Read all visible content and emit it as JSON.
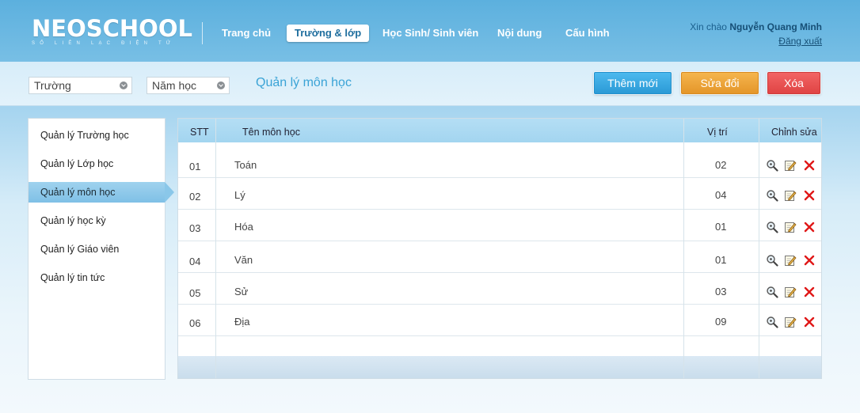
{
  "header": {
    "logo_title": "NEOSCHOOL",
    "logo_subtitle": "SỔ LIÊN LẠC ĐIỆN TỬ",
    "nav": [
      {
        "label": "Trang chủ",
        "active": false
      },
      {
        "label": "Trường & lớp",
        "active": true
      },
      {
        "label": "Học Sinh/ Sinh viên",
        "active": false
      },
      {
        "label": "Nội dung",
        "active": false
      },
      {
        "label": "Cấu hình",
        "active": false
      }
    ],
    "greeting": "Xin chào",
    "user_name": "Nguyễn Quang Minh",
    "logout": "Đăng xuất"
  },
  "toolbar": {
    "school_select": "Trường",
    "year_select": "Năm học",
    "section_title": "Quản lý môn học",
    "add_label": "Thêm mới",
    "edit_label": "Sửa đổi",
    "delete_label": "Xóa"
  },
  "sidebar": {
    "items": [
      {
        "label": "Quản lý Trường học",
        "active": false
      },
      {
        "label": "Quản lý Lớp học",
        "active": false
      },
      {
        "label": "Quản lý môn học",
        "active": true
      },
      {
        "label": "Quản lý học kỳ",
        "active": false
      },
      {
        "label": "Quản lý Giáo viên",
        "active": false
      },
      {
        "label": "Quản lý tin tức",
        "active": false
      }
    ]
  },
  "table": {
    "columns": {
      "stt": "STT",
      "name": "Tên môn học",
      "position": "Vị trí",
      "actions": "Chỉnh sửa"
    },
    "rows": [
      {
        "stt": "01",
        "name": "Toán",
        "position": "02"
      },
      {
        "stt": "02",
        "name": "Lý",
        "position": "04"
      },
      {
        "stt": "03",
        "name": "Hóa",
        "position": "01"
      },
      {
        "stt": "04",
        "name": "Văn",
        "position": "01"
      },
      {
        "stt": "05",
        "name": "Sử",
        "position": "03"
      },
      {
        "stt": "06",
        "name": "Địa",
        "position": "09"
      }
    ],
    "action_icons": [
      "zoom-icon",
      "edit-icon",
      "delete-icon"
    ]
  },
  "colors": {
    "accent": "#3aa3d6",
    "add_button": "#2b9ad6",
    "edit_button": "#e4962a",
    "delete_button": "#e04444"
  }
}
